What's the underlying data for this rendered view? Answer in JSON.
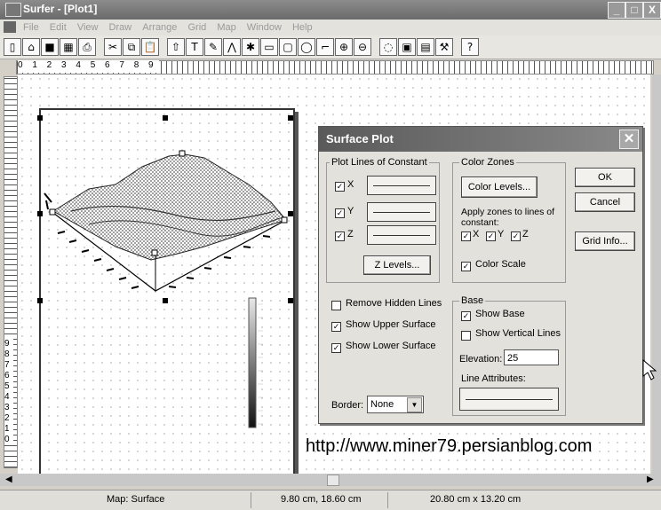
{
  "window": {
    "title": "Surfer - [Plot1]",
    "controls": [
      "_",
      "□",
      "X"
    ]
  },
  "menu": {
    "items": [
      "File",
      "Edit",
      "View",
      "Draw",
      "Arrange",
      "Grid",
      "Map",
      "Window",
      "Help"
    ]
  },
  "toolbar": {
    "buttons": [
      "new-icon",
      "open-icon",
      "save-icon",
      "grid-icon",
      "print-icon",
      "cut-icon",
      "copy-icon",
      "paste-icon",
      "pointer-icon",
      "text-icon",
      "polygon-icon",
      "polyline-icon",
      "symbol-icon",
      "rectangle-icon",
      "rounded-rect-icon",
      "ellipse-icon",
      "reshape-icon",
      "zoom-in-icon",
      "zoom-out-icon",
      "map-icon",
      "grid-data-icon",
      "grid-node-icon",
      "wizard-icon",
      "help-icon"
    ],
    "glyphs": [
      "▯",
      "⌂",
      "■",
      "▦",
      "⎙",
      "✂",
      "⧉",
      "📋",
      "⇧",
      "T",
      "✎",
      "⋀",
      "✱",
      "▭",
      "▢",
      "◯",
      "⌐",
      "⊕",
      "⊖",
      "◌",
      "▣",
      "▤",
      "⚒",
      "?"
    ]
  },
  "ruler": {
    "numbers": "0 1 2 3 4 5 6 7 8 9"
  },
  "vruler": {
    "numbers": "9 8 7 6 5 4 3 2 1 0"
  },
  "dialog": {
    "title": "Surface Plot",
    "plot_lines": {
      "label": "Plot Lines of Constant",
      "x": "X",
      "y": "Y",
      "z": "Z",
      "z_levels": "Z Levels..."
    },
    "color_zones": {
      "label": "Color Zones",
      "color_levels": "Color Levels...",
      "apply_text": "Apply zones to lines of constant:",
      "x": "X",
      "y": "Y",
      "z": "Z",
      "color_scale": "Color Scale"
    },
    "ok": "OK",
    "cancel": "Cancel",
    "grid_info": "Grid Info...",
    "remove_hidden": "Remove Hidden Lines",
    "show_upper": "Show Upper Surface",
    "show_lower": "Show Lower Surface",
    "base": {
      "label": "Base",
      "show_base": "Show Base",
      "show_vertical": "Show Vertical Lines",
      "elevation_label": "Elevation:",
      "elevation_value": "25",
      "line_attributes": "Line Attributes:"
    },
    "border": {
      "label": "Border:",
      "value": "None"
    }
  },
  "url_overlay": "http://www.miner79.persianblog.com",
  "status": {
    "mode": "Map: Surface",
    "position": "9.80 cm, 18.60 cm",
    "size": "20.80 cm x 13.20 cm"
  }
}
